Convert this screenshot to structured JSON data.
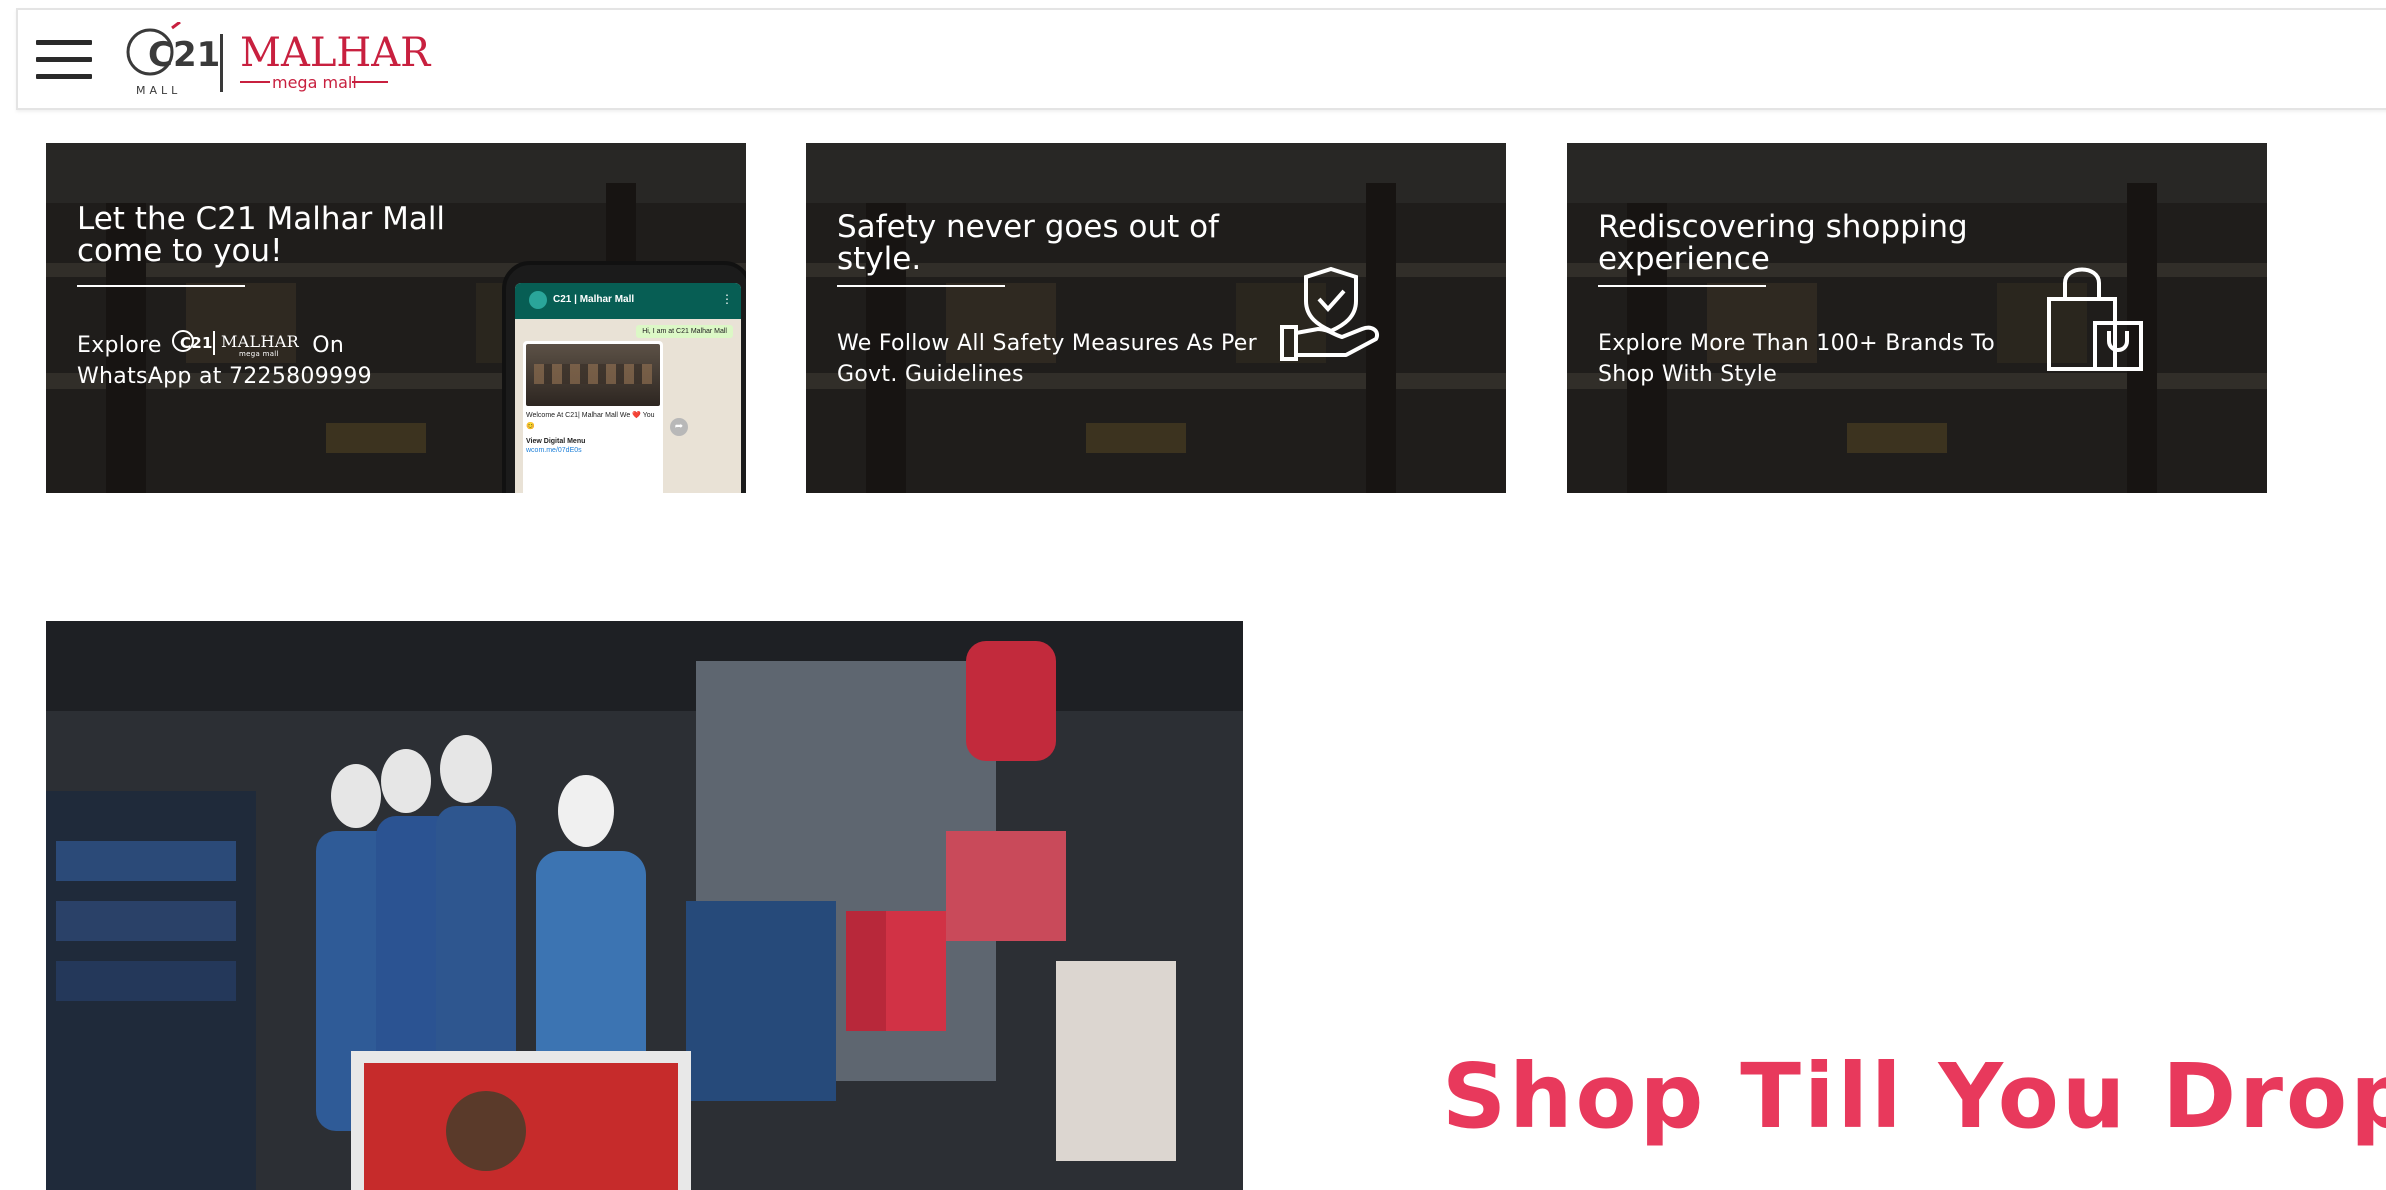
{
  "header": {
    "menu_label": "Menu",
    "logo": {
      "c21": "C21",
      "c21_sub": "MALL",
      "brand": "MALHAR",
      "brand_sub": "mega mall"
    }
  },
  "cards": [
    {
      "title": "Let the C21 Malhar Mall come to you!",
      "sub_before": "Explore",
      "sub_after": "On",
      "sub_line2": "WhatsApp at 7225809999",
      "icon": "whatsapp-phone",
      "phone": {
        "chat_name": "C21 | Malhar Mall",
        "out_msg": "Hi, I am at C21 Malhar Mall",
        "in_msg": "Welcome At C21| Malhar Mall We ❤️ You 😊",
        "menu": "View Digital Menu",
        "link": "wcom.me/07dE0s"
      }
    },
    {
      "title": "Safety never goes out of style.",
      "sub": "We Follow All Safety Measures As Per Govt. Guidelines",
      "icon": "shield-hand-icon"
    },
    {
      "title": "Rediscovering shopping experience",
      "sub": "Explore More Than 100+ Brands To Shop With Style",
      "icon": "shopping-bag-icon"
    }
  ],
  "hero": {
    "tagline": "Shop Till You Drop"
  },
  "colors": {
    "brand_red": "#c8203f",
    "tagline": "#e8395c",
    "header_border": "#e4e4e4"
  }
}
